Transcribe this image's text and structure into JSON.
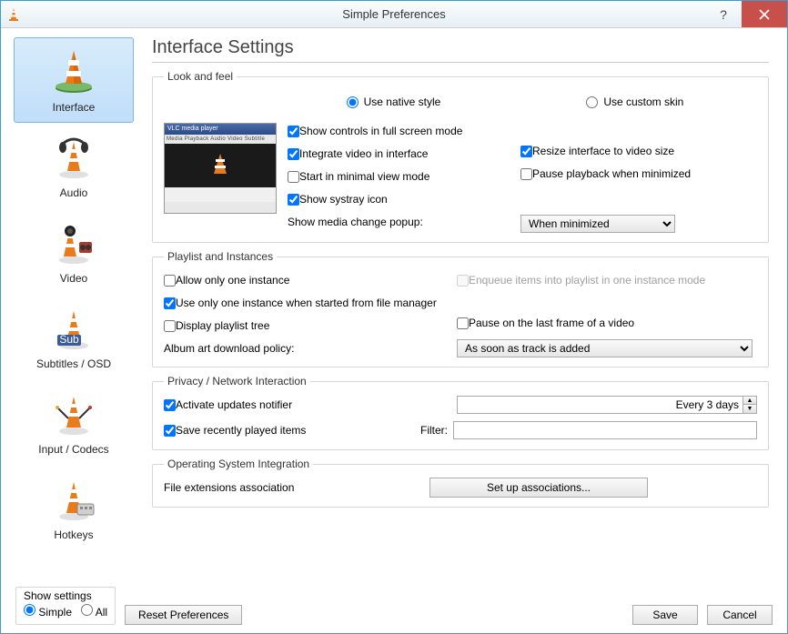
{
  "window": {
    "title": "Simple Preferences"
  },
  "sidebar": {
    "items": [
      {
        "label": "Interface"
      },
      {
        "label": "Audio"
      },
      {
        "label": "Video"
      },
      {
        "label": "Subtitles / OSD"
      },
      {
        "label": "Input / Codecs"
      },
      {
        "label": "Hotkeys"
      }
    ],
    "selected": 0
  },
  "page": {
    "title": "Interface Settings"
  },
  "look": {
    "legend": "Look and feel",
    "native": "Use native style",
    "custom": "Use custom skin",
    "preview_title": "VLC media player",
    "preview_menu": "Media Playback Audio Video Subtitle Tools View Help",
    "show_controls": "Show controls in full screen mode",
    "integrate_video": "Integrate video in interface",
    "minimal_view": "Start in minimal view mode",
    "systray": "Show systray icon",
    "resize": "Resize interface to video size",
    "pause_min": "Pause playback when minimized",
    "popup_label": "Show media change popup:",
    "popup_value": "When minimized"
  },
  "playlist": {
    "legend": "Playlist and Instances",
    "one_instance": "Allow only one instance",
    "enqueue": "Enqueue items into playlist in one instance mode",
    "fm_instance": "Use only one instance when started from file manager",
    "display_tree": "Display playlist tree",
    "pause_last": "Pause on the last frame of a video",
    "art_label": "Album art download policy:",
    "art_value": "As soon as track is added"
  },
  "privacy": {
    "legend": "Privacy / Network Interaction",
    "updates": "Activate updates notifier",
    "updates_value": "Every 3 days",
    "save_recent": "Save recently played items",
    "filter_label": "Filter:",
    "filter_value": ""
  },
  "os": {
    "legend": "Operating System Integration",
    "file_ext": "File extensions association",
    "setup": "Set up associations..."
  },
  "bottom": {
    "show_settings": "Show settings",
    "simple": "Simple",
    "all": "All",
    "reset": "Reset Preferences",
    "save": "Save",
    "cancel": "Cancel"
  }
}
